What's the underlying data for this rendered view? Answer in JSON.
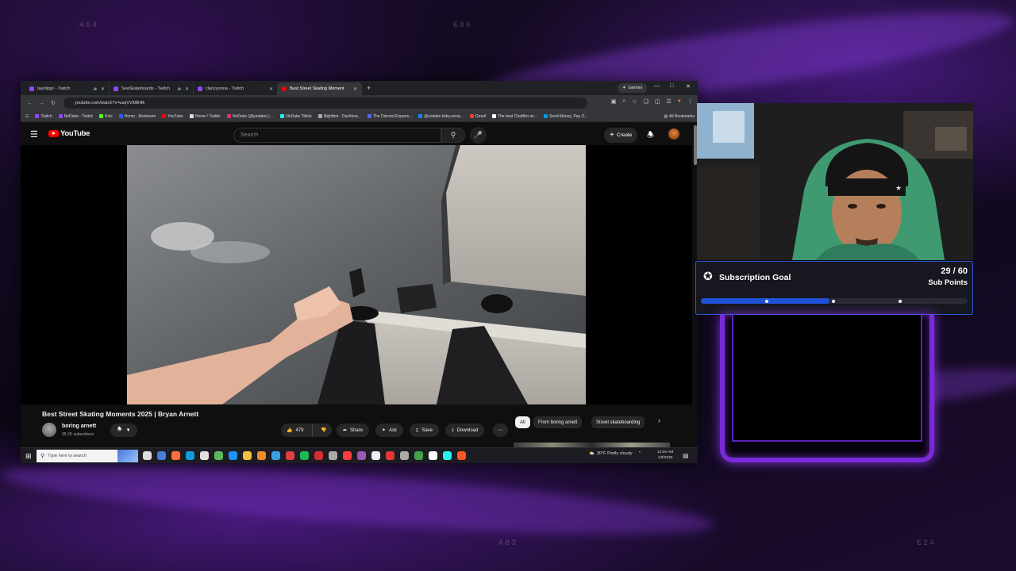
{
  "overlay": {
    "corner_labels": [
      "A64",
      "E80",
      "A83",
      "E24"
    ]
  },
  "browser": {
    "tabs": [
      {
        "title": "tayotippr - Twitch",
        "color": "#9146ff",
        "active": false
      },
      {
        "title": "SeaSkateboards - Twitch",
        "color": "#9146ff",
        "active": false
      },
      {
        "title": "clancyonna - Twitch",
        "color": "#9146ff",
        "active": false
      },
      {
        "title": "Best Street Skating Moment",
        "color": "#ff0000",
        "active": true
      }
    ],
    "gemini_label": "Gemini",
    "url": "youtube.com/watch?v=usqVVl08Hfk",
    "bookmarks": [
      {
        "label": "Twitch",
        "color": "#9146ff"
      },
      {
        "label": "NoDake - Twitch",
        "color": "#9146ff"
      },
      {
        "label": "Kick",
        "color": "#53fc18"
      },
      {
        "label": "Home - Restream",
        "color": "#2b5cff"
      },
      {
        "label": "YouTube",
        "color": "#ff0000"
      },
      {
        "label": "Home / Twitter",
        "color": "#dddddd"
      },
      {
        "label": "NoDake (@yodake) | ...",
        "color": "#e1306c"
      },
      {
        "label": "NoDake Tiktok",
        "color": "#25f4ee"
      },
      {
        "label": "Nightbot - Dashboa...",
        "color": "#aaaaaa"
      },
      {
        "label": "The Discord Expans...",
        "color": "#5865f2"
      },
      {
        "label": "@yodake.bsky.socia...",
        "color": "#1185fe"
      },
      {
        "label": "Gmail",
        "color": "#ea4335"
      },
      {
        "label": "The best ChatBot an...",
        "color": "#ffffff"
      },
      {
        "label": "Send Money, Pay O...",
        "color": "#009cde"
      }
    ],
    "all_bookmarks_label": "All Bookmarks"
  },
  "youtube": {
    "logo_text": "YouTube",
    "search_placeholder": "Search",
    "create_label": "Create",
    "video_title": "Best Street Skating Moments 2025 | Bryan Arnett",
    "channel_name": "boring arnett",
    "subscribers": "95.2K subscribers",
    "likes": "479",
    "share_label": "Share",
    "ask_label": "Ask",
    "save_label": "Save",
    "download_label": "Download",
    "chips": [
      "All",
      "From boring arnett",
      "Street skateboarding"
    ]
  },
  "taskbar": {
    "search_placeholder": "Type here to search",
    "weather": "30°F  Partly cloudy",
    "time": "12:00 AM",
    "date": "1/9/2026"
  },
  "sub_goal": {
    "title": "Subscription Goal",
    "count": "29 / 60",
    "unit": "Sub Points",
    "current": 29,
    "target": 60,
    "fill_color": "#1f53d6",
    "border_color": "#2d5bd6"
  }
}
